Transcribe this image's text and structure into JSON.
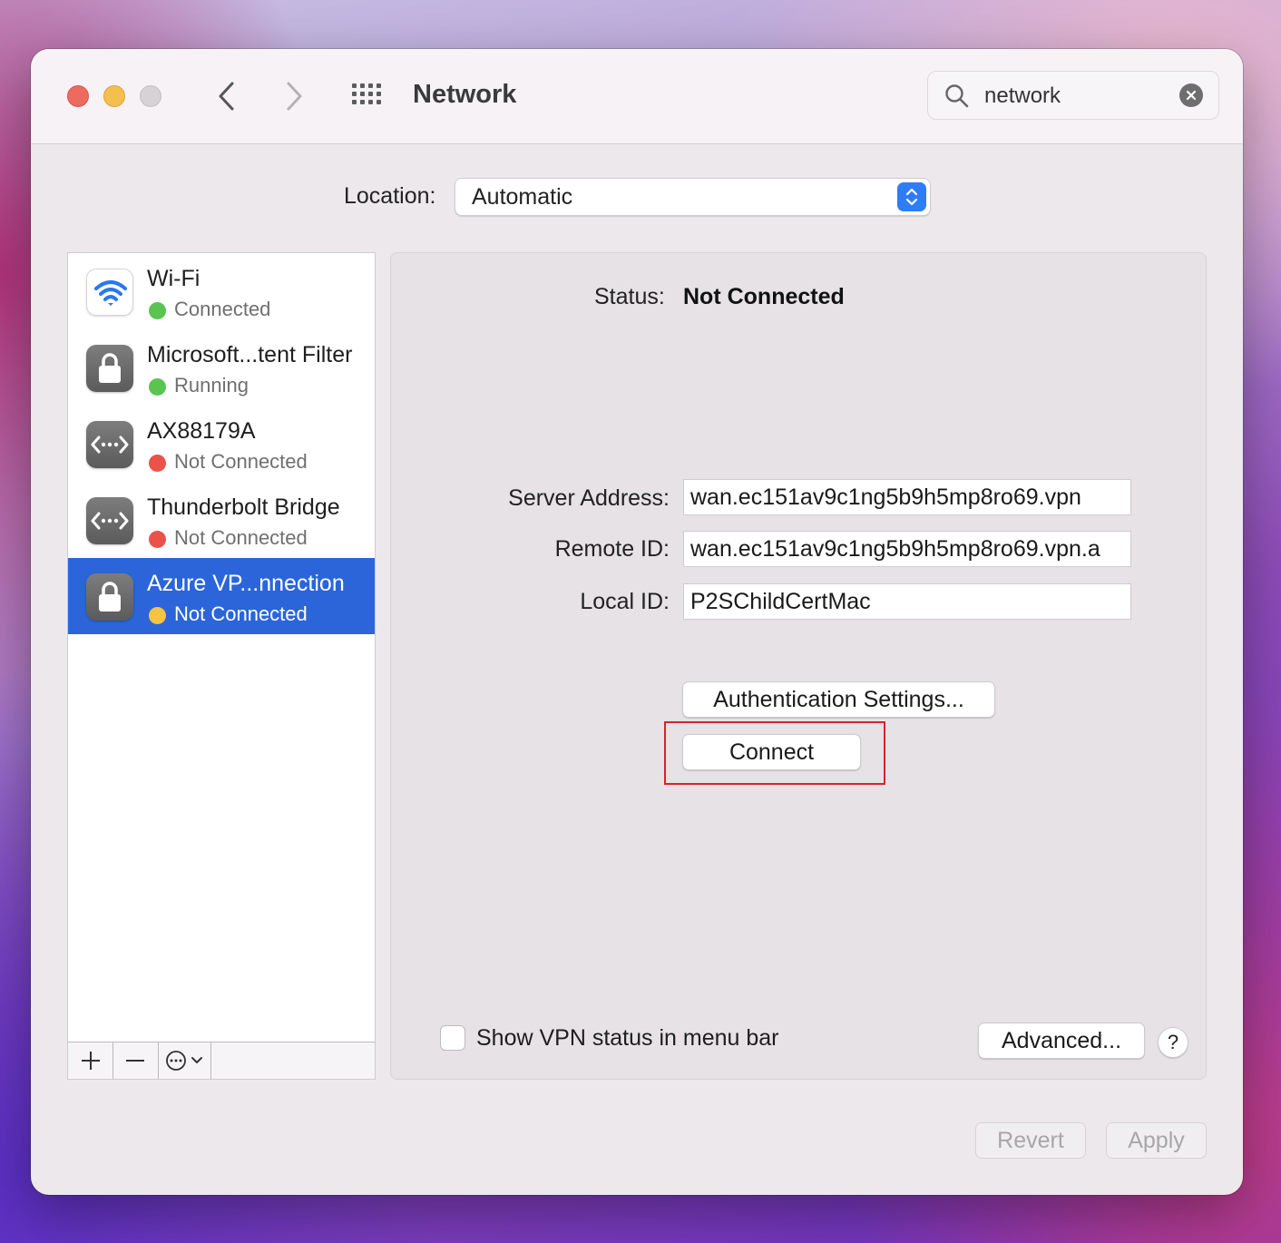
{
  "window": {
    "title": "Network",
    "search": {
      "value": "network"
    },
    "location": {
      "label": "Location:",
      "value": "Automatic"
    }
  },
  "sidebar": {
    "services": [
      {
        "name": "Wi-Fi",
        "status": "Connected",
        "status_color": "#5ac451",
        "icon": "wifi-icon",
        "selected": false
      },
      {
        "name": "Microsoft...tent Filter",
        "status": "Running",
        "status_color": "#5ac451",
        "icon": "lock-icon",
        "selected": false
      },
      {
        "name": "AX88179A",
        "status": "Not Connected",
        "status_color": "#e9534a",
        "icon": "ethernet-icon",
        "selected": false
      },
      {
        "name": "Thunderbolt Bridge",
        "status": "Not Connected",
        "status_color": "#e9534a",
        "icon": "ethernet-icon",
        "selected": false
      },
      {
        "name": "Azure VP...nnection",
        "status": "Not Connected",
        "status_color": "#f6c343",
        "icon": "lock-icon",
        "selected": true
      }
    ],
    "footer": {
      "add": "+",
      "remove": "—"
    }
  },
  "detail": {
    "status_label": "Status:",
    "status_value": "Not Connected",
    "fields": [
      {
        "label": "Server Address:",
        "value": "wan.ec151av9c1ng5b9h5mp8ro69.vpn"
      },
      {
        "label": "Remote ID:",
        "value": "wan.ec151av9c1ng5b9h5mp8ro69.vpn.a"
      },
      {
        "label": "Local ID:",
        "value": "P2SChildCertMac"
      }
    ],
    "auth_button": "Authentication Settings...",
    "connect_button": "Connect",
    "show_vpn_status_label": "Show VPN status in menu bar",
    "show_vpn_status_checked": false,
    "advanced_button": "Advanced...",
    "help_button": "?"
  },
  "footer": {
    "revert": "Revert",
    "apply": "Apply"
  },
  "colors": {
    "accent": "#2f7df6",
    "selection": "#2b65d9",
    "highlight_box": "#d8232a"
  }
}
